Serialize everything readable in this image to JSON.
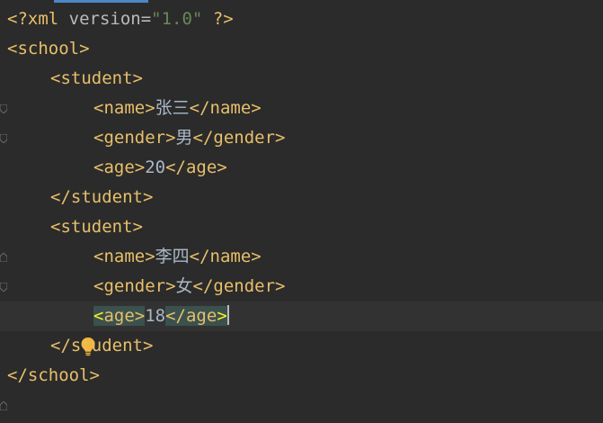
{
  "editor": {
    "lines": [
      {
        "parts": [
          "<?xml",
          " version",
          "=",
          "\"1.0\"",
          " ?>"
        ]
      },
      {
        "tag": "<school>"
      },
      {
        "tag": "<student>"
      },
      {
        "open": "<name>",
        "text": "张三",
        "close": "</name>"
      },
      {
        "open": "<gender>",
        "text": "男",
        "close": "</gender>"
      },
      {
        "open": "<age>",
        "text": "20",
        "close": "</age>"
      },
      {
        "tag": "</student>"
      },
      {
        "tag": "<student>"
      },
      {
        "open": "<name>",
        "text": "李四",
        "close": "</name>"
      },
      {
        "open": "<gender>",
        "text": "女",
        "close": "</gender>"
      },
      {
        "open_lt": "<",
        "open_rest": "age>",
        "text": "18",
        "close_rest": "</age",
        "close_gt": ">"
      },
      {
        "tag": "</student>"
      },
      {
        "tag": "</school>"
      }
    ]
  },
  "colors": {
    "background": "#2b2b2b",
    "tag": "#e8bf6a",
    "text": "#a9b7c6",
    "string": "#6a8759",
    "current_line": "#323232",
    "match_highlight": "#3b514d"
  },
  "icons": {
    "gutter_bulb": "lightbulb-icon",
    "fold_marker": "fold-marker-icon"
  }
}
